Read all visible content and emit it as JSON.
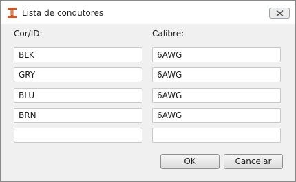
{
  "window": {
    "title": "Lista de condutores",
    "close_icon": "close-icon",
    "app_icon": "i-beam-icon"
  },
  "columns": {
    "color_id_label": "Cor/ID:",
    "gauge_label": "Calibre:"
  },
  "rows": [
    {
      "color_id": "BLK",
      "gauge": "6AWG"
    },
    {
      "color_id": "GRY",
      "gauge": "6AWG"
    },
    {
      "color_id": "BLU",
      "gauge": "6AWG"
    },
    {
      "color_id": "BRN",
      "gauge": "6AWG"
    },
    {
      "color_id": "",
      "gauge": ""
    }
  ],
  "buttons": {
    "ok_label": "OK",
    "cancel_label": "Cancelar"
  },
  "colors": {
    "icon_orange": "#d9531e",
    "close_x": "#4d4d4d"
  }
}
